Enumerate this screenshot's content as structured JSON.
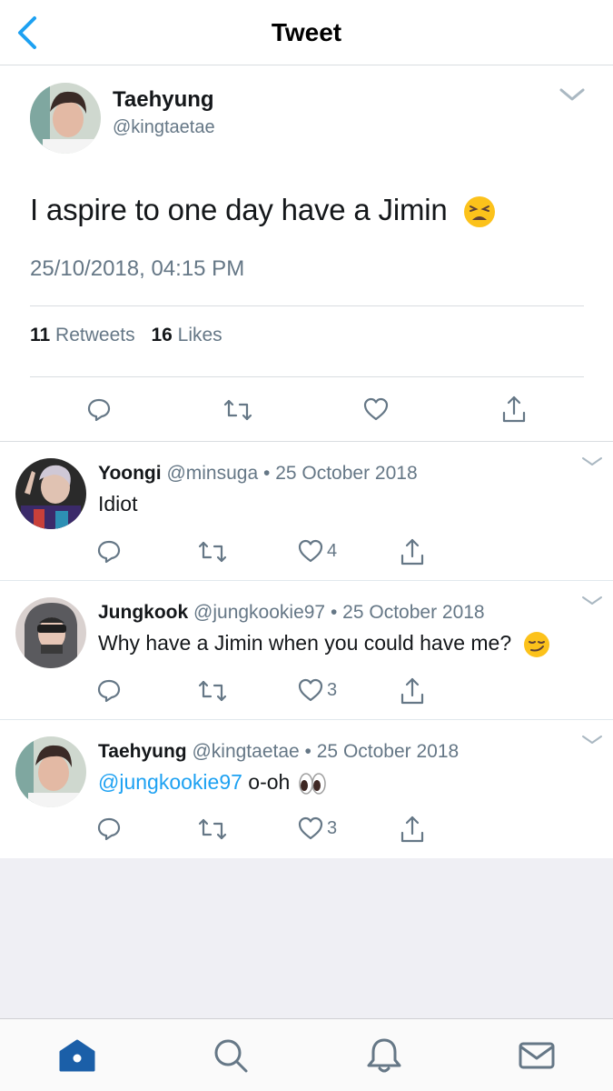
{
  "header": {
    "title": "Tweet"
  },
  "main_tweet": {
    "name": "Taehyung",
    "handle": "@kingtaetae",
    "text": "I aspire to one day have a Jimin",
    "emoji": "tired-face-emoji",
    "timestamp": "25/10/2018, 04:15 PM",
    "retweets_count": "11",
    "retweets_label": "Retweets",
    "likes_count": "16",
    "likes_label": "Likes"
  },
  "replies": [
    {
      "name": "Yoongi",
      "handle": "@minsuga",
      "separator": "•",
      "date": "25 October 2018",
      "text": "Idiot",
      "likes": "4"
    },
    {
      "name": "Jungkook",
      "handle": "@jungkookie97",
      "separator": "•",
      "date": "25 October 2018",
      "text": "Why have a Jimin when you could have me?",
      "emoji": "smirking-face-emoji",
      "likes": "3"
    },
    {
      "name": "Taehyung",
      "handle": "@kingtaetae",
      "separator": "•",
      "date": "25 October 2018",
      "mention": "@jungkookie97",
      "text": "o-oh",
      "emoji": "eyes-emoji",
      "likes": "3"
    }
  ],
  "tab_bar": {
    "items": [
      "home-icon",
      "search-icon",
      "notifications-icon",
      "messages-icon"
    ],
    "active": "home-icon"
  },
  "colors": {
    "accent": "#1da1f2",
    "tab_active": "#1b5fa8",
    "secondary_text": "#657786",
    "divider": "#d9dde1",
    "background_gray": "#efeff4"
  }
}
